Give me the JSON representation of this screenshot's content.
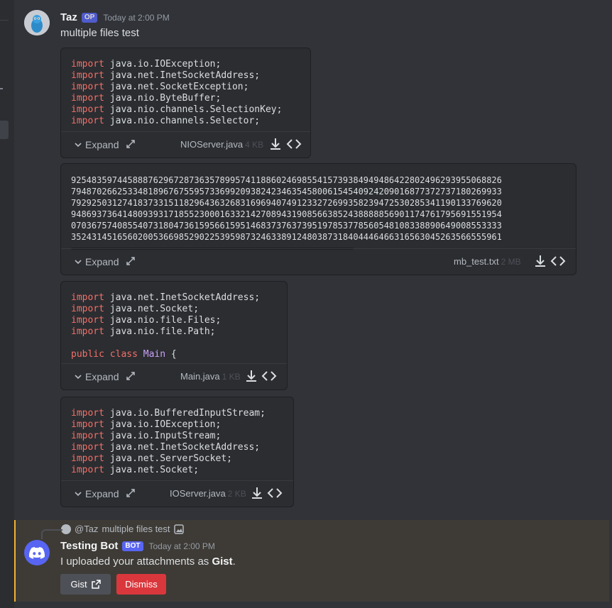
{
  "message1": {
    "author": "Taz",
    "badge": "OP",
    "timestamp": "Today at 2:00 PM",
    "text": "multiple files test"
  },
  "attachments": [
    {
      "filename": "NIOServer.java",
      "size": "4 KB",
      "expand_label": "Expand",
      "lines": [
        [
          "import",
          " java.io.IOException;"
        ],
        [
          "import",
          " java.net.InetSocketAddress;"
        ],
        [
          "import",
          " java.net.SocketException;"
        ],
        [
          "import",
          " java.nio.ByteBuffer;"
        ],
        [
          "import",
          " java.nio.channels.SelectionKey;"
        ],
        [
          "import",
          " java.nio.channels.Selector;"
        ]
      ]
    },
    {
      "filename": "mb_test.txt",
      "size": "2 MB",
      "expand_label": "Expand",
      "text_lines": [
        "925483597445888762967287363578995741188602469855415739384949486422802496293955068826",
        "794870266253348189676755957336992093824234635458006154540924209016877372737180269933",
        "792925031274183733151182964363268316969407491233272699358239472530285341190133769620",
        "948693736414809393171855230001633214270894319085663852438888856901174761795691551954",
        "070367574085540731804736159566159514683737637395197853778560548108338890649008553333",
        "352431451656020053669852902253959873246338912480387318404446466316563045263566555961"
      ]
    },
    {
      "filename": "Main.java",
      "size": "1 KB",
      "expand_label": "Expand",
      "lines": [
        [
          "import",
          " java.net.InetSocketAddress;"
        ],
        [
          "import",
          " java.net.Socket;"
        ],
        [
          "import",
          " java.nio.file.Files;"
        ],
        [
          "import",
          " java.nio.file.Path;"
        ],
        [
          "",
          ""
        ],
        [
          "public class",
          " ",
          "Main",
          " {"
        ]
      ]
    },
    {
      "filename": "IOServer.java",
      "size": "2 KB",
      "expand_label": "Expand",
      "lines": [
        [
          "import",
          " java.io.BufferedInputStream;"
        ],
        [
          "import",
          " java.io.IOException;"
        ],
        [
          "import",
          " java.io.InputStream;"
        ],
        [
          "import",
          " java.net.InetSocketAddress;"
        ],
        [
          "import",
          " java.net.ServerSocket;"
        ],
        [
          "import",
          " java.net.Socket;"
        ]
      ]
    }
  ],
  "message2": {
    "reply_author": "@Taz",
    "reply_text": "multiple files test",
    "author": "Testing Bot",
    "badge": "BOT",
    "timestamp": "Today at 2:00 PM",
    "text_prefix": "I uploaded your attachments as ",
    "text_bold": "Gist",
    "text_suffix": ".",
    "buttons": {
      "gist": "Gist",
      "dismiss": "Dismiss"
    }
  },
  "colors": {
    "accent": "#5865f2",
    "highlight": "#f0b232",
    "danger": "#da373c",
    "keyword": "#f47067",
    "class_name": "#c9a0f5"
  },
  "icons": [
    "expand-chevron-icon",
    "fullscreen-icon",
    "download-icon",
    "view-source-icon",
    "external-link-icon",
    "discord-logo-icon",
    "image-icon"
  ]
}
